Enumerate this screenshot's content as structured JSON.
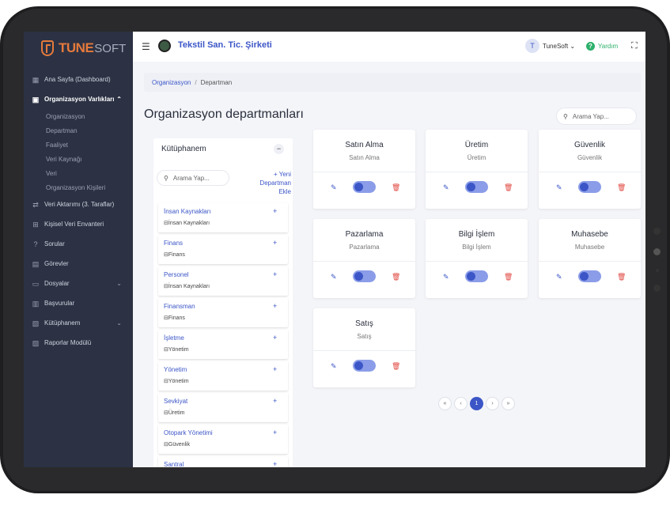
{
  "brand": {
    "part1": "TUNE",
    "part2": "SOFT"
  },
  "sidebar": {
    "items": [
      {
        "label": "Ana Sayfa (Dashboard)",
        "icon": "dashboard-icon"
      },
      {
        "label": "Organizasyon Varlıkları",
        "icon": "building-icon",
        "expanded": true
      },
      {
        "label": "Veri Aktarımı (3. Taraflar)",
        "icon": "transfer-icon"
      },
      {
        "label": "Kişisel Veri Envanteri",
        "icon": "table-icon"
      },
      {
        "label": "Sorular",
        "icon": "question-icon"
      },
      {
        "label": "Görevler",
        "icon": "clipboard-icon"
      },
      {
        "label": "Dosyalar",
        "icon": "folder-icon"
      },
      {
        "label": "Başvurular",
        "icon": "application-icon"
      },
      {
        "label": "Kütüphanem",
        "icon": "library-icon"
      },
      {
        "label": "Raporlar Modülü",
        "icon": "report-icon"
      }
    ],
    "subitems": [
      "Organizasyon",
      "Departman",
      "Faaliyet",
      "Veri Kaynağı",
      "Veri",
      "Organizasyon Kişileri"
    ]
  },
  "topbar": {
    "company": "Tekstil San. Tic. Şirketi",
    "user_initial": "T",
    "user_name": "TuneSoft",
    "help": "Yardım"
  },
  "breadcrumb": {
    "root": "Organizasyon",
    "current": "Departman"
  },
  "page_title": "Organizasyon departmanları",
  "search": {
    "placeholder": "Arama Yap..."
  },
  "library": {
    "title": "Kütüphanem",
    "search_placeholder": "Arama Yap...",
    "new_department": "+ Yeni Departman Ekle",
    "items": [
      {
        "name": "İnsan Kaynakları",
        "sub": "İnsan Kaynakları"
      },
      {
        "name": "Finans",
        "sub": "Finans"
      },
      {
        "name": "Personel",
        "sub": "İnsan Kaynakları"
      },
      {
        "name": "Finansman",
        "sub": "Finans"
      },
      {
        "name": "İşletme",
        "sub": "Yönetim"
      },
      {
        "name": "Yönetim",
        "sub": "Yönetim"
      },
      {
        "name": "Sevkiyat",
        "sub": "Üretim"
      },
      {
        "name": "Otopark Yönetimi",
        "sub": "Güvenlik"
      },
      {
        "name": "Santral",
        "sub": ""
      }
    ]
  },
  "departments": [
    {
      "name": "Satın Alma",
      "sub": "Satın Alma",
      "active": true
    },
    {
      "name": "Üretim",
      "sub": "Üretim",
      "active": true
    },
    {
      "name": "Güvenlik",
      "sub": "Güvenlik",
      "active": true
    },
    {
      "name": "Pazarlama",
      "sub": "Pazarlama",
      "active": true
    },
    {
      "name": "Bilgi İşlem",
      "sub": "Bilgi İşlem",
      "active": true
    },
    {
      "name": "Muhasebe",
      "sub": "Muhasebe",
      "active": true
    },
    {
      "name": "Satış",
      "sub": "Satış",
      "active": true
    }
  ],
  "pagination": {
    "first": "«",
    "prev": "‹",
    "current": "1",
    "next": "›",
    "last": "»"
  },
  "colors": {
    "accent": "#3c56c7",
    "sidebar": "#2c3244",
    "brand": "#e57a3c",
    "help": "#2db06a",
    "danger": "#e0463f"
  }
}
